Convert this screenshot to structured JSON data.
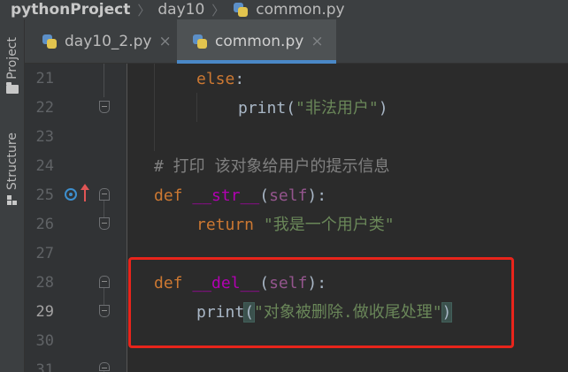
{
  "breadcrumb": {
    "project": "pythonProject",
    "folder": "day10",
    "file": "common.py"
  },
  "toolwindows": {
    "project": "Project",
    "structure": "Structure"
  },
  "tabs": [
    {
      "label": "day10_2.py",
      "active": false
    },
    {
      "label": "common.py",
      "active": true
    }
  ],
  "tab_close_glyph": "×",
  "editor": {
    "lines": [
      {
        "num": "21",
        "tokens": [
          {
            "t": "else",
            "c": "kw"
          },
          {
            "t": ":",
            "c": "plain"
          }
        ]
      },
      {
        "num": "22",
        "tokens": [
          {
            "t": "print",
            "c": "plain"
          },
          {
            "t": "(",
            "c": "plain"
          },
          {
            "t": "\"非法用户\"",
            "c": "str"
          },
          {
            "t": ")",
            "c": "plain"
          }
        ]
      },
      {
        "num": "23",
        "tokens": []
      },
      {
        "num": "24",
        "tokens": [
          {
            "t": "# 打印 该对象给用户的提示信息",
            "c": "cmt"
          }
        ]
      },
      {
        "num": "25",
        "tokens": [
          {
            "t": "def ",
            "c": "kw"
          },
          {
            "t": "__str__",
            "c": "fn"
          },
          {
            "t": "(",
            "c": "plain"
          },
          {
            "t": "self",
            "c": "self"
          },
          {
            "t": "):",
            "c": "plain"
          }
        ]
      },
      {
        "num": "26",
        "tokens": [
          {
            "t": "return ",
            "c": "kw"
          },
          {
            "t": "\"我是一个用户类\"",
            "c": "str"
          }
        ]
      },
      {
        "num": "27",
        "tokens": []
      },
      {
        "num": "28",
        "tokens": [
          {
            "t": "def ",
            "c": "kw"
          },
          {
            "t": "__del__",
            "c": "fn"
          },
          {
            "t": "(",
            "c": "plain"
          },
          {
            "t": "self",
            "c": "self"
          },
          {
            "t": "):",
            "c": "plain"
          }
        ]
      },
      {
        "num": "29",
        "tokens": [
          {
            "t": "print",
            "c": "plain"
          },
          {
            "t": "(",
            "c": "brace"
          },
          {
            "t": "\"对象被删除.做收尾处理\"",
            "c": "str"
          },
          {
            "t": ")",
            "c": "brace"
          }
        ]
      },
      {
        "num": "30",
        "tokens": []
      },
      {
        "num": "31",
        "tokens": []
      }
    ],
    "current_line": "29"
  },
  "colors": {
    "accent": "#4a88c7",
    "highlight_box": "#e8241b",
    "keyword": "#cc7832",
    "string": "#6a8759",
    "comment": "#808080",
    "dunder": "#b200b2",
    "self": "#94558d"
  },
  "icons": [
    "python-file-icon",
    "folder-icon",
    "structure-icon",
    "override-icon",
    "implemented-arrow-icon",
    "fold-icon"
  ]
}
